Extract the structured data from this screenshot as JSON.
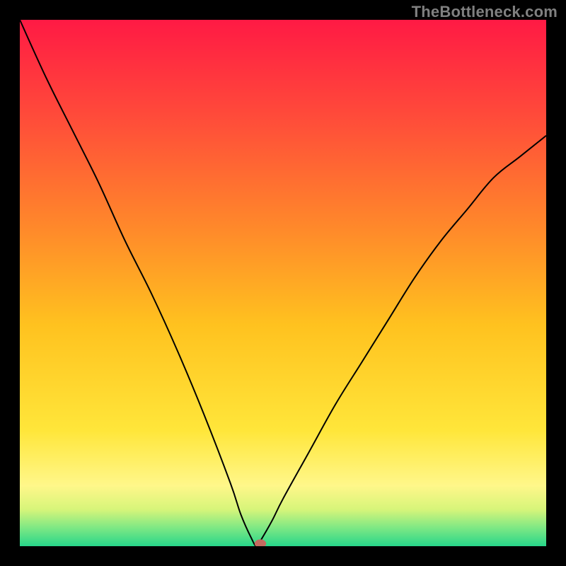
{
  "attribution": "TheBottleneck.com",
  "chart_data": {
    "type": "line",
    "title": "",
    "xlabel": "",
    "ylabel": "",
    "xlim": [
      0,
      100
    ],
    "ylim": [
      0,
      100
    ],
    "background_gradient_stops": [
      {
        "offset": 0,
        "color": "#ff1a44"
      },
      {
        "offset": 0.18,
        "color": "#ff4a3a"
      },
      {
        "offset": 0.4,
        "color": "#ff8a2a"
      },
      {
        "offset": 0.58,
        "color": "#ffc21f"
      },
      {
        "offset": 0.78,
        "color": "#ffe63a"
      },
      {
        "offset": 0.885,
        "color": "#fff78a"
      },
      {
        "offset": 0.93,
        "color": "#d7f57a"
      },
      {
        "offset": 0.965,
        "color": "#7ee884"
      },
      {
        "offset": 1.0,
        "color": "#27d68a"
      }
    ],
    "series": [
      {
        "name": "bottleneck-curve",
        "color": "#000000",
        "x": [
          0,
          5,
          10,
          15,
          20,
          25,
          30,
          35,
          40,
          42,
          44,
          45,
          46,
          48,
          50,
          55,
          60,
          65,
          70,
          75,
          80,
          85,
          90,
          95,
          100
        ],
        "y": [
          100,
          89,
          79,
          69,
          58,
          48,
          37,
          25,
          12,
          6,
          1.5,
          0,
          1.5,
          5,
          9,
          18,
          27,
          35,
          43,
          51,
          58,
          64,
          70,
          74,
          78
        ]
      }
    ],
    "marker": {
      "x": 45.7,
      "y": 0.5,
      "rx": 1.1,
      "ry": 0.8,
      "color": "#c46a60"
    }
  }
}
